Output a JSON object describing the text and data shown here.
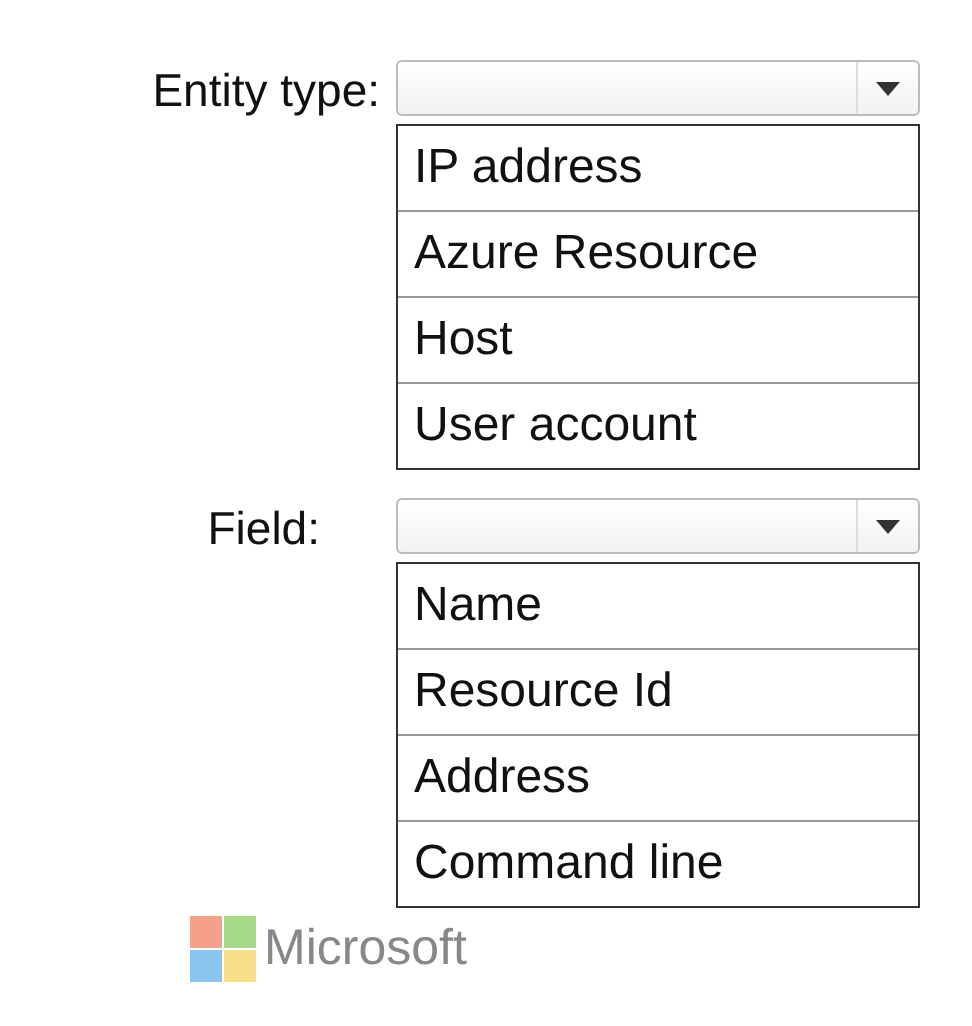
{
  "dropdowns": [
    {
      "label": "Entity type:",
      "options": [
        "IP address",
        "Azure Resource",
        "Host",
        "User account"
      ]
    },
    {
      "label": "Field:",
      "options": [
        "Name",
        "Resource Id",
        "Address",
        "Command line"
      ]
    }
  ],
  "logo": {
    "text": "Microsoft"
  }
}
